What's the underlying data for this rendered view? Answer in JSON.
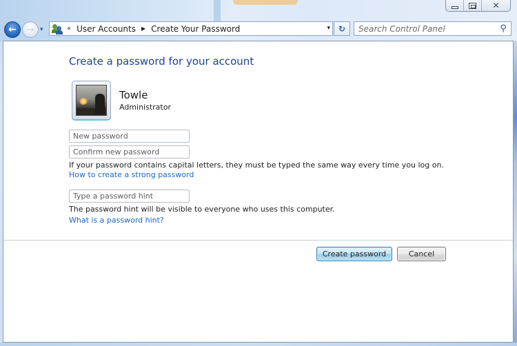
{
  "window": {
    "caption_buttons": {
      "minimize_icon": "minimize-icon",
      "maximize_icon": "restore-icon",
      "close_icon": "close-icon",
      "close_glyph": "✕"
    }
  },
  "navigation": {
    "back_icon": "back-arrow-icon",
    "back_glyph": "←",
    "forward_icon": "forward-arrow-icon",
    "forward_glyph": "→",
    "history_glyph": "▾",
    "breadcrumb": {
      "icon": "user-accounts-icon",
      "overflow_glyph": "«",
      "segments": [
        "User Accounts",
        "Create Your Password"
      ],
      "separator_glyph": "▶",
      "dropdown_glyph": "▾"
    },
    "refresh_glyph": "↻",
    "search": {
      "placeholder": "Search Control Panel",
      "value": "",
      "icon_glyph": "⚲"
    }
  },
  "page": {
    "title": "Create a password for your account",
    "user": {
      "name": "Towle",
      "role": "Administrator"
    },
    "fields": {
      "new_password_placeholder": "New password",
      "confirm_password_placeholder": "Confirm new password",
      "hint_placeholder": "Type a password hint"
    },
    "capital_letters_note": "If your password contains capital letters, they must be typed the same way every time you log on.",
    "strong_password_link": "How to create a strong password",
    "hint_note": "The password hint will be visible to everyone who uses this computer.",
    "hint_link": "What is a password hint?",
    "buttons": {
      "create": "Create password",
      "cancel": "Cancel"
    }
  },
  "colors": {
    "title": "#1c3fa0",
    "link": "#1e66c8",
    "primary_button": "#98d1ef"
  }
}
